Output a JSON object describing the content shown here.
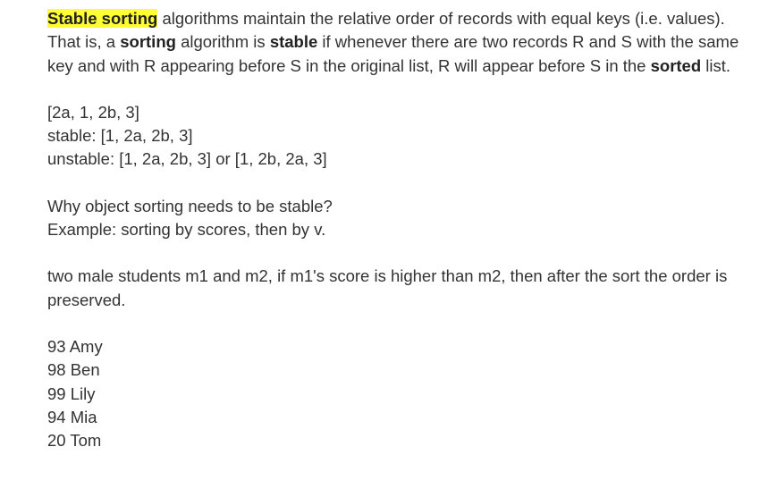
{
  "intro": {
    "highlight": "Stable sorting",
    "t1": " algorithms maintain the relative order of records with equal keys (i.e. values). That is, a ",
    "b1": "sorting",
    "t2": " algorithm is ",
    "b2": "stable",
    "t3": " if whenever there are two records R and S with the same key and with R appearing before S in the original list, R will appear before S in the ",
    "b3": "sorted",
    "t4": " list."
  },
  "example": {
    "line1": "[2a, 1, 2b, 3]",
    "line2": "stable: [1, 2a, 2b, 3]",
    "line3": "unstable: [1, 2a, 2b, 3] or [1, 2b, 2a, 3]"
  },
  "why": {
    "line1": "Why object sorting needs to be stable?",
    "line2": "Example: sorting by scores, then by  v."
  },
  "students": {
    "text": "two male students m1 and m2, if m1's score is higher than m2, then after the sort the order is preserved."
  },
  "scores": [
    "93 Amy",
    "98 Ben",
    "99 Lily",
    "94 Mia",
    "20 Tom"
  ]
}
